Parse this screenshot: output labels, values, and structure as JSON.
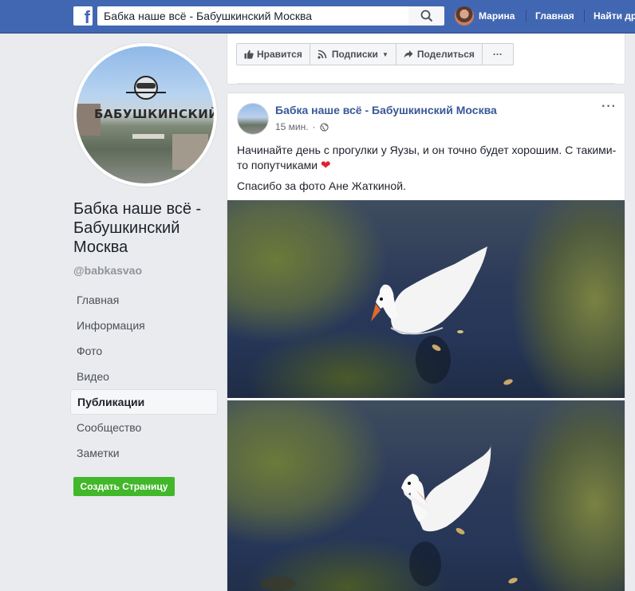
{
  "topbar": {
    "logo": "f",
    "search_value": "Бабка наше всё - Бабушкинский Москва",
    "user_name": "Марина",
    "nav_home": "Главная",
    "nav_find": "Найти др"
  },
  "sidebar": {
    "page_name": "Бабка наше всё - Бабушкинский Москва",
    "handle": "@babkasvao",
    "profile_brand": "БАБУШКИНСКИЙ",
    "items": [
      {
        "label": "Главная",
        "active": false
      },
      {
        "label": "Информация",
        "active": false
      },
      {
        "label": "Фото",
        "active": false
      },
      {
        "label": "Видео",
        "active": false
      },
      {
        "label": "Публикации",
        "active": true
      },
      {
        "label": "Сообщество",
        "active": false
      },
      {
        "label": "Заметки",
        "active": false
      }
    ],
    "create_button": "Создать Страницу"
  },
  "actions": {
    "like": "Нравится",
    "follow": "Подписки",
    "share": "Поделиться",
    "more": "···"
  },
  "post": {
    "author": "Бабка наше всё - Бабушкинский Москва",
    "time": "15 мин.",
    "text_line1": "Начинайте день с прогулки у Яузы, и он точно будет хорошим. С такими-то попутчиками",
    "text_line2": "Спасибо за фото Ане Жаткиной.",
    "more": "···"
  },
  "colors": {
    "topbar": "#4267b2",
    "link": "#385898",
    "create_button": "#42b72a",
    "heart": "#e4202e"
  }
}
